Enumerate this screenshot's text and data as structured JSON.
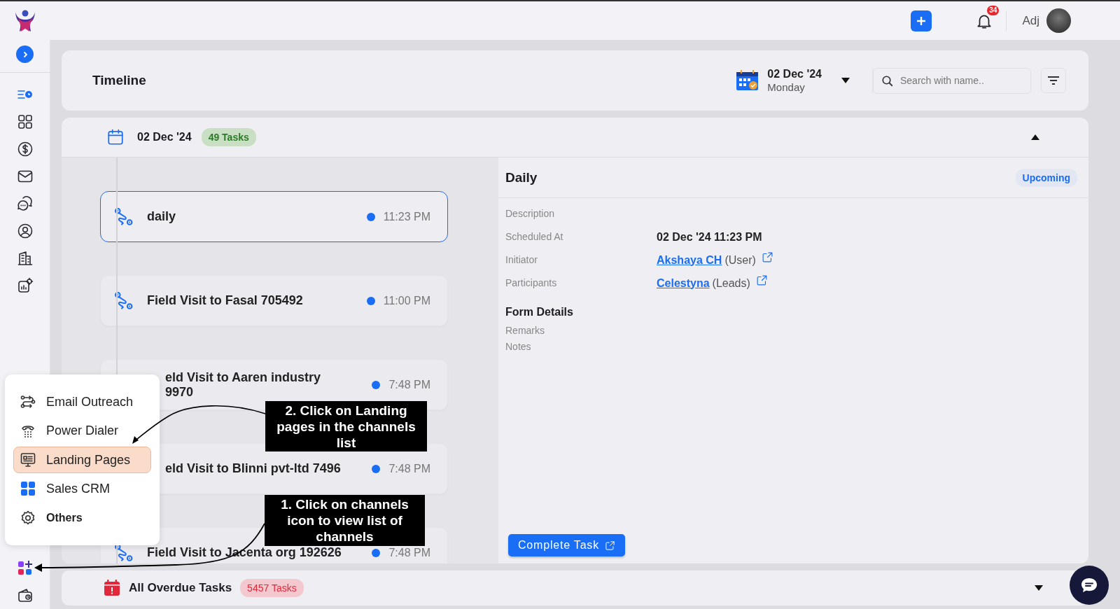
{
  "topbar": {
    "user_name": "Adj",
    "notification_count": "34"
  },
  "sidebar": {
    "items": [
      {
        "kind": "timeline",
        "selected": true
      },
      {
        "kind": "grid",
        "selected": false
      },
      {
        "kind": "dollar",
        "selected": false
      },
      {
        "kind": "mail",
        "selected": false
      },
      {
        "kind": "chat",
        "selected": false
      },
      {
        "kind": "user",
        "selected": false
      },
      {
        "kind": "building",
        "selected": false
      },
      {
        "kind": "report",
        "selected": false
      }
    ],
    "bottom_items": [
      {
        "kind": "channels"
      },
      {
        "kind": "wallet"
      }
    ]
  },
  "page": {
    "title": "Timeline",
    "date": "02 Dec '24",
    "weekday": "Monday",
    "search_placeholder": "Search with name.."
  },
  "day_group": {
    "date": "02 Dec '24",
    "count": "49 Tasks",
    "expanded": true
  },
  "tasks": [
    {
      "title": "daily",
      "time": "11:23 PM",
      "selected": true,
      "show_icon": true
    },
    {
      "title": "Field Visit to Fasal 705492",
      "time": "11:00 PM",
      "selected": false,
      "show_icon": true
    },
    {
      "title": "eld Visit to Aaren industry 9970",
      "time": "7:48 PM",
      "selected": false,
      "show_icon": false
    },
    {
      "title": "eld Visit to Blinni pvt-ltd 7496",
      "time": "7:48 PM",
      "selected": false,
      "show_icon": false
    },
    {
      "title": "Field Visit to Jacenta org 192626",
      "time": "7:48 PM",
      "selected": false,
      "show_icon": true
    }
  ],
  "detail": {
    "title": "Daily",
    "status": "Upcoming",
    "fields": [
      {
        "label": "Description"
      },
      {
        "label": "Scheduled At",
        "value": "02 Dec '24 11:23 PM"
      },
      {
        "label": "Initiator",
        "link": "Akshaya CH",
        "note": "(User)"
      },
      {
        "label": "Participants",
        "link": "Celestyna",
        "note": "(Leads)"
      }
    ],
    "form_title": "Form Details",
    "form_fields": [
      "Remarks",
      "Notes"
    ],
    "action": "Complete Task"
  },
  "overdue": {
    "label": "All Overdue Tasks",
    "count": "5457 Tasks",
    "expanded": false
  },
  "channel_menu": [
    {
      "label": "Email Outreach",
      "kind": "outreach",
      "selected": false
    },
    {
      "label": "Power Dialer",
      "kind": "dialer",
      "selected": false
    },
    {
      "label": "Landing Pages",
      "kind": "landing",
      "selected": true
    },
    {
      "label": "Sales CRM",
      "kind": "crm",
      "selected": false
    },
    {
      "label": "Others",
      "kind": "others",
      "selected": false
    }
  ],
  "annotations": [
    "2. Click on Landing pages in the channels list",
    "1. Click on channels icon to view list of channels"
  ]
}
